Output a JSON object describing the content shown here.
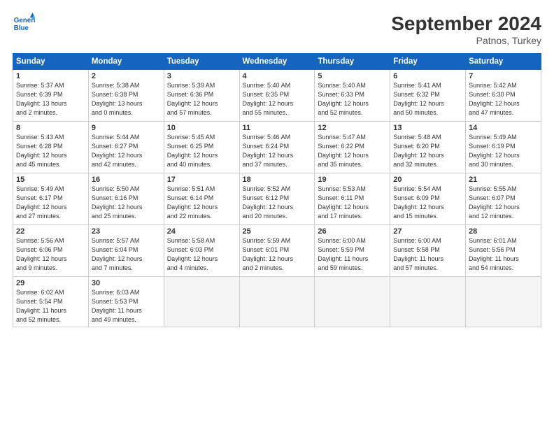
{
  "header": {
    "logo_line1": "General",
    "logo_line2": "Blue",
    "month_title": "September 2024",
    "location": "Patnos, Turkey"
  },
  "weekdays": [
    "Sunday",
    "Monday",
    "Tuesday",
    "Wednesday",
    "Thursday",
    "Friday",
    "Saturday"
  ],
  "days": [
    {
      "num": "",
      "info": ""
    },
    {
      "num": "",
      "info": ""
    },
    {
      "num": "",
      "info": ""
    },
    {
      "num": "",
      "info": ""
    },
    {
      "num": "",
      "info": ""
    },
    {
      "num": "",
      "info": ""
    },
    {
      "num": "1",
      "info": "Sunrise: 5:37 AM\nSunset: 6:39 PM\nDaylight: 13 hours\nand 2 minutes."
    },
    {
      "num": "2",
      "info": "Sunrise: 5:38 AM\nSunset: 6:38 PM\nDaylight: 13 hours\nand 0 minutes."
    },
    {
      "num": "3",
      "info": "Sunrise: 5:39 AM\nSunset: 6:36 PM\nDaylight: 12 hours\nand 57 minutes."
    },
    {
      "num": "4",
      "info": "Sunrise: 5:40 AM\nSunset: 6:35 PM\nDaylight: 12 hours\nand 55 minutes."
    },
    {
      "num": "5",
      "info": "Sunrise: 5:40 AM\nSunset: 6:33 PM\nDaylight: 12 hours\nand 52 minutes."
    },
    {
      "num": "6",
      "info": "Sunrise: 5:41 AM\nSunset: 6:32 PM\nDaylight: 12 hours\nand 50 minutes."
    },
    {
      "num": "7",
      "info": "Sunrise: 5:42 AM\nSunset: 6:30 PM\nDaylight: 12 hours\nand 47 minutes."
    },
    {
      "num": "8",
      "info": "Sunrise: 5:43 AM\nSunset: 6:28 PM\nDaylight: 12 hours\nand 45 minutes."
    },
    {
      "num": "9",
      "info": "Sunrise: 5:44 AM\nSunset: 6:27 PM\nDaylight: 12 hours\nand 42 minutes."
    },
    {
      "num": "10",
      "info": "Sunrise: 5:45 AM\nSunset: 6:25 PM\nDaylight: 12 hours\nand 40 minutes."
    },
    {
      "num": "11",
      "info": "Sunrise: 5:46 AM\nSunset: 6:24 PM\nDaylight: 12 hours\nand 37 minutes."
    },
    {
      "num": "12",
      "info": "Sunrise: 5:47 AM\nSunset: 6:22 PM\nDaylight: 12 hours\nand 35 minutes."
    },
    {
      "num": "13",
      "info": "Sunrise: 5:48 AM\nSunset: 6:20 PM\nDaylight: 12 hours\nand 32 minutes."
    },
    {
      "num": "14",
      "info": "Sunrise: 5:49 AM\nSunset: 6:19 PM\nDaylight: 12 hours\nand 30 minutes."
    },
    {
      "num": "15",
      "info": "Sunrise: 5:49 AM\nSunset: 6:17 PM\nDaylight: 12 hours\nand 27 minutes."
    },
    {
      "num": "16",
      "info": "Sunrise: 5:50 AM\nSunset: 6:16 PM\nDaylight: 12 hours\nand 25 minutes."
    },
    {
      "num": "17",
      "info": "Sunrise: 5:51 AM\nSunset: 6:14 PM\nDaylight: 12 hours\nand 22 minutes."
    },
    {
      "num": "18",
      "info": "Sunrise: 5:52 AM\nSunset: 6:12 PM\nDaylight: 12 hours\nand 20 minutes."
    },
    {
      "num": "19",
      "info": "Sunrise: 5:53 AM\nSunset: 6:11 PM\nDaylight: 12 hours\nand 17 minutes."
    },
    {
      "num": "20",
      "info": "Sunrise: 5:54 AM\nSunset: 6:09 PM\nDaylight: 12 hours\nand 15 minutes."
    },
    {
      "num": "21",
      "info": "Sunrise: 5:55 AM\nSunset: 6:07 PM\nDaylight: 12 hours\nand 12 minutes."
    },
    {
      "num": "22",
      "info": "Sunrise: 5:56 AM\nSunset: 6:06 PM\nDaylight: 12 hours\nand 9 minutes."
    },
    {
      "num": "23",
      "info": "Sunrise: 5:57 AM\nSunset: 6:04 PM\nDaylight: 12 hours\nand 7 minutes."
    },
    {
      "num": "24",
      "info": "Sunrise: 5:58 AM\nSunset: 6:03 PM\nDaylight: 12 hours\nand 4 minutes."
    },
    {
      "num": "25",
      "info": "Sunrise: 5:59 AM\nSunset: 6:01 PM\nDaylight: 12 hours\nand 2 minutes."
    },
    {
      "num": "26",
      "info": "Sunrise: 6:00 AM\nSunset: 5:59 PM\nDaylight: 11 hours\nand 59 minutes."
    },
    {
      "num": "27",
      "info": "Sunrise: 6:00 AM\nSunset: 5:58 PM\nDaylight: 11 hours\nand 57 minutes."
    },
    {
      "num": "28",
      "info": "Sunrise: 6:01 AM\nSunset: 5:56 PM\nDaylight: 11 hours\nand 54 minutes."
    },
    {
      "num": "29",
      "info": "Sunrise: 6:02 AM\nSunset: 5:54 PM\nDaylight: 11 hours\nand 52 minutes."
    },
    {
      "num": "30",
      "info": "Sunrise: 6:03 AM\nSunset: 5:53 PM\nDaylight: 11 hours\nand 49 minutes."
    },
    {
      "num": "",
      "info": ""
    },
    {
      "num": "",
      "info": ""
    },
    {
      "num": "",
      "info": ""
    },
    {
      "num": "",
      "info": ""
    },
    {
      "num": "",
      "info": ""
    }
  ]
}
